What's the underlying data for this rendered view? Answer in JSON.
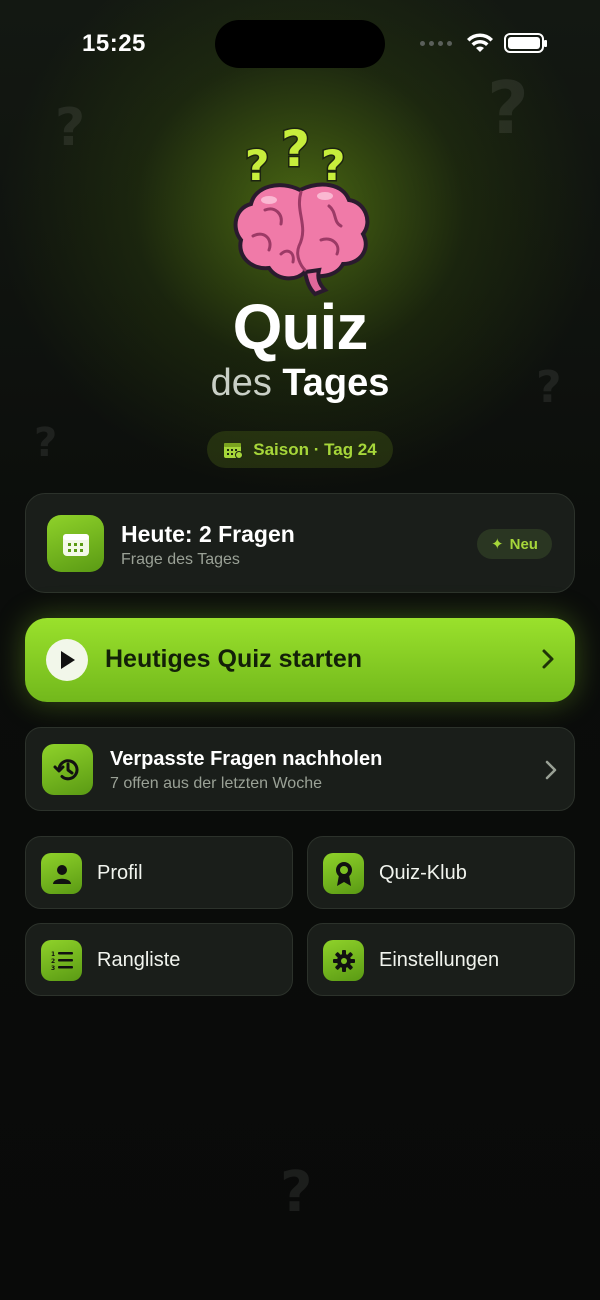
{
  "status": {
    "time": "15:25"
  },
  "hero": {
    "title": "Quiz",
    "subtitle_light": "des",
    "subtitle_bold": "Tages",
    "season": "Saison · Tag 24"
  },
  "today": {
    "title": "Heute: 2 Fragen",
    "subtitle": "Frage des Tages",
    "badge": "Neu"
  },
  "start": {
    "label": "Heutiges Quiz starten"
  },
  "missed": {
    "title": "Verpasste Fragen nachholen",
    "subtitle": "7 offen aus der letzten Woche"
  },
  "tiles": [
    {
      "label": "Profil",
      "icon": "person-icon"
    },
    {
      "label": "Quiz-Klub",
      "icon": "award-icon"
    },
    {
      "label": "Rangliste",
      "icon": "ranked-list-icon"
    },
    {
      "label": "Einstellungen",
      "icon": "gear-icon"
    }
  ],
  "colors": {
    "accent": "#8fd22a",
    "accent_text": "#a6d63a",
    "background": "#0b0d0b",
    "card": "#1a1e1a"
  }
}
